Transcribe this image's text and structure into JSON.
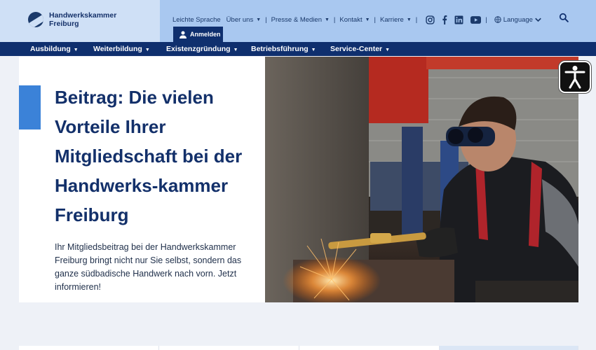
{
  "header": {
    "logo_line1": "Handwerkskammer",
    "logo_line2": "Freiburg",
    "meta_links": [
      {
        "label": "Leichte Sprache"
      },
      {
        "label": "Über uns"
      },
      {
        "label": "Presse & Medien"
      },
      {
        "label": "Kontakt"
      },
      {
        "label": "Karriere"
      }
    ],
    "language_label": "Language",
    "login_label": "Anmelden",
    "colors": {
      "top_bar": "#a9c8f0",
      "logo_cell": "#cfe0f6",
      "navy": "#0f2f6e",
      "accent": "#3b82d8"
    }
  },
  "nav": {
    "items": [
      {
        "label": "Ausbildung"
      },
      {
        "label": "Weiterbildung"
      },
      {
        "label": "Existenzgründung"
      },
      {
        "label": "Betriebsführung"
      },
      {
        "label": "Service-Center"
      }
    ]
  },
  "hero": {
    "title": "Beitrag: Die vielen Vorteile Ihrer Mitgliedschaft bei der Handwerks-kammer Freiburg",
    "text": "Ihr Mitgliedsbeitrag bei der Handwerkskammer Freiburg bringt nicht nur Sie selbst, sondern das ganze südbadische Handwerk nach vorn. Jetzt informieren!"
  },
  "icons": {
    "search": "search-icon",
    "user": "user-icon",
    "instagram": "instagram-icon",
    "facebook": "facebook-icon",
    "linkedin": "linkedin-icon",
    "youtube": "youtube-icon",
    "globe": "globe-icon",
    "accessibility": "accessibility-icon"
  }
}
